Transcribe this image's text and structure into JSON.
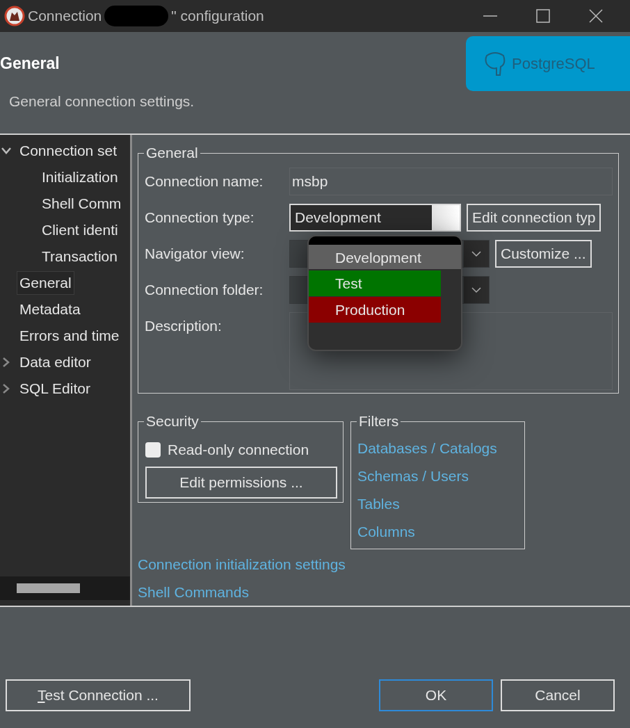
{
  "window": {
    "title_start": "Connection",
    "title_end": "\" configuration"
  },
  "header": {
    "title": "General",
    "description": "General connection settings.",
    "logo_text": "PostgreSQL"
  },
  "sidebar": {
    "items": [
      {
        "label": "Connection set",
        "expanded": true,
        "selected": false,
        "children": [
          {
            "label": "Initialization",
            "selected": false
          },
          {
            "label": "Shell Comm",
            "selected": false
          },
          {
            "label": "Client identi",
            "selected": false
          },
          {
            "label": "Transaction",
            "selected": false
          }
        ]
      },
      {
        "label": "General",
        "selected": true
      },
      {
        "label": "Metadata",
        "selected": false
      },
      {
        "label": "Errors and time",
        "selected": false
      },
      {
        "label": "Data editor",
        "expanded": false,
        "selected": false
      },
      {
        "label": "SQL Editor",
        "expanded": false,
        "selected": false
      }
    ]
  },
  "general_group": {
    "legend": "General",
    "fields": [
      {
        "kind": "text",
        "label": "Connection name:",
        "value": "msbp"
      },
      {
        "kind": "type-combo",
        "label": "Connection type:",
        "value": "Development",
        "button": "Edit connection typ"
      },
      {
        "kind": "combo",
        "label": "Navigator view:",
        "button": "Customize ..."
      },
      {
        "kind": "combo",
        "label": "Connection folder:"
      },
      {
        "kind": "textarea",
        "label": "Description:"
      }
    ]
  },
  "type_dropdown": {
    "options": [
      {
        "label": "Development",
        "color": "#e2e2e2",
        "selected": true
      },
      {
        "label": "Test",
        "color": "#007400",
        "selected": false
      },
      {
        "label": "Production",
        "color": "#8b0000",
        "selected": false
      }
    ]
  },
  "security": {
    "legend": "Security",
    "read_only": {
      "label": "Read-only connection",
      "checked": false
    },
    "button": "Edit permissions ..."
  },
  "filters": {
    "legend": "Filters",
    "links": [
      "Databases / Catalogs",
      "Schemas / Users",
      "Tables",
      "Columns"
    ]
  },
  "links": [
    "Connection initialization settings",
    "Shell Commands"
  ],
  "buttons": [
    {
      "label": "Test Connection ...",
      "mnemonic": true,
      "default": false
    },
    {
      "label": "OK",
      "mnemonic": false,
      "default": true
    },
    {
      "label": "Cancel",
      "mnemonic": false,
      "default": false
    }
  ]
}
